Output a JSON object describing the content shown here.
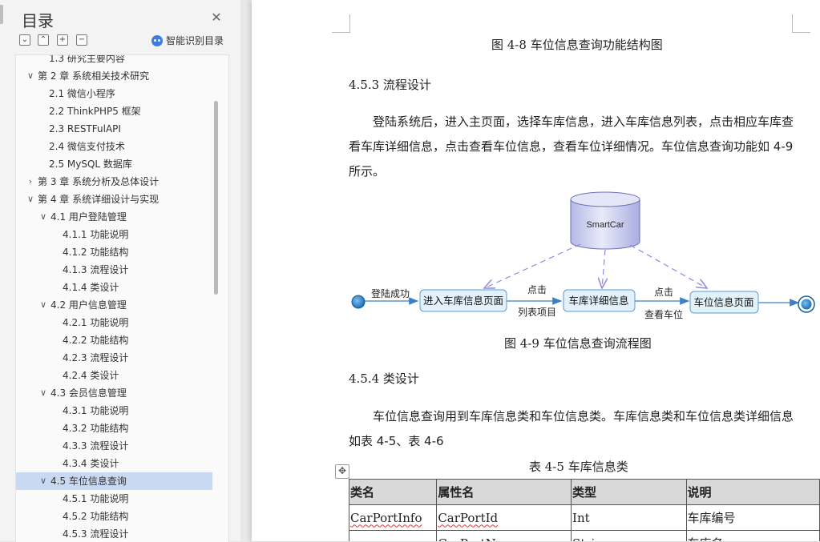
{
  "sidebar": {
    "title": "目录",
    "smart_label": "智能识别目录",
    "items": [
      {
        "label": "1.3 研究主要内容",
        "level": 2,
        "arrow": ""
      },
      {
        "label": "第 2 章  系统相关技术研究",
        "level": 1,
        "arrow": "expanded"
      },
      {
        "label": "2.1  微信小程序",
        "level": 2,
        "arrow": ""
      },
      {
        "label": "2.2 ThinkPHP5 框架",
        "level": 2,
        "arrow": ""
      },
      {
        "label": "2.3 RESTFulAPI",
        "level": 2,
        "arrow": ""
      },
      {
        "label": "2.4  微信支付技术",
        "level": 2,
        "arrow": ""
      },
      {
        "label": "2.5 MySQL 数据库",
        "level": 2,
        "arrow": ""
      },
      {
        "label": "第 3 章  系统分析及总体设计",
        "level": 1,
        "arrow": "collapsed"
      },
      {
        "label": "第 4 章  系统详细设计与实现",
        "level": 1,
        "arrow": "expanded"
      },
      {
        "label": "4.1 用户登陆管理",
        "level": 2,
        "arrow": "expanded"
      },
      {
        "label": "4.1.1 功能说明",
        "level": 3,
        "arrow": ""
      },
      {
        "label": "4.1.2 功能结构",
        "level": 3,
        "arrow": ""
      },
      {
        "label": "4.1.3 流程设计",
        "level": 3,
        "arrow": ""
      },
      {
        "label": "4.1.4 类设计",
        "level": 3,
        "arrow": ""
      },
      {
        "label": "4.2 用户信息管理",
        "level": 2,
        "arrow": "expanded"
      },
      {
        "label": "4.2.1 功能说明",
        "level": 3,
        "arrow": ""
      },
      {
        "label": "4.2.2 功能结构",
        "level": 3,
        "arrow": ""
      },
      {
        "label": "4.2.3 流程设计",
        "level": 3,
        "arrow": ""
      },
      {
        "label": "4.2.4 类设计",
        "level": 3,
        "arrow": ""
      },
      {
        "label": "4.3 会员信息管理",
        "level": 2,
        "arrow": "expanded"
      },
      {
        "label": "4.3.1 功能说明",
        "level": 3,
        "arrow": ""
      },
      {
        "label": "4.3.2 功能结构",
        "level": 3,
        "arrow": ""
      },
      {
        "label": "4.3.3 流程设计",
        "level": 3,
        "arrow": ""
      },
      {
        "label": "4.3.4 类设计",
        "level": 3,
        "arrow": ""
      },
      {
        "label": "4.5 车位信息查询",
        "level": 2,
        "arrow": "expanded",
        "active": true
      },
      {
        "label": "4.5.1 功能说明",
        "level": 3,
        "arrow": ""
      },
      {
        "label": "4.5.2 功能结构",
        "level": 3,
        "arrow": ""
      },
      {
        "label": "4.5.3 流程设计",
        "level": 3,
        "arrow": ""
      }
    ]
  },
  "document": {
    "fig48_caption": "图 4-8  车位信息查询功能结构图",
    "heading_453": "4.5.3 流程设计",
    "para1": "登陆系统后，进入主页面，选择车库信息，进入车库信息列表，点击相应车库查看车库详细信息，点击查看车位信息，查看车位详细情况。车位信息查询功能如 4-9 所示。",
    "diagram": {
      "db_label": "SmartCar",
      "nodes": [
        "进入车库信息页面",
        "车库详细信息",
        "车位信息页面"
      ],
      "edge_labels": [
        "登陆成功",
        "点击",
        "列表项目",
        "点击",
        "查看车位"
      ]
    },
    "fig49_caption": "图 4-9  车位信息查询流程图",
    "heading_454": "4.5.4 类设计",
    "para2": "车位信息查询用到车库信息类和车位信息类。车库信息类和车位信息类详细信息如表 4-5、表 4-6",
    "table_caption": "表 4-5  车库信息类",
    "table": {
      "headers": [
        "类名",
        "属性名",
        "类型",
        "说明"
      ],
      "rows": [
        [
          "CarPortInfo",
          "CarPortId",
          "Int",
          "车库编号"
        ],
        [
          "",
          "CarPortName",
          "String",
          "车库名"
        ]
      ]
    }
  },
  "colors": {
    "flow_arrow": "#3a7fc7",
    "dashed_arrow": "#8c8ce6",
    "node_fill": "#e3f1fb",
    "db_fill": "#c5c9ec",
    "active_item": "#c9d9f2"
  }
}
